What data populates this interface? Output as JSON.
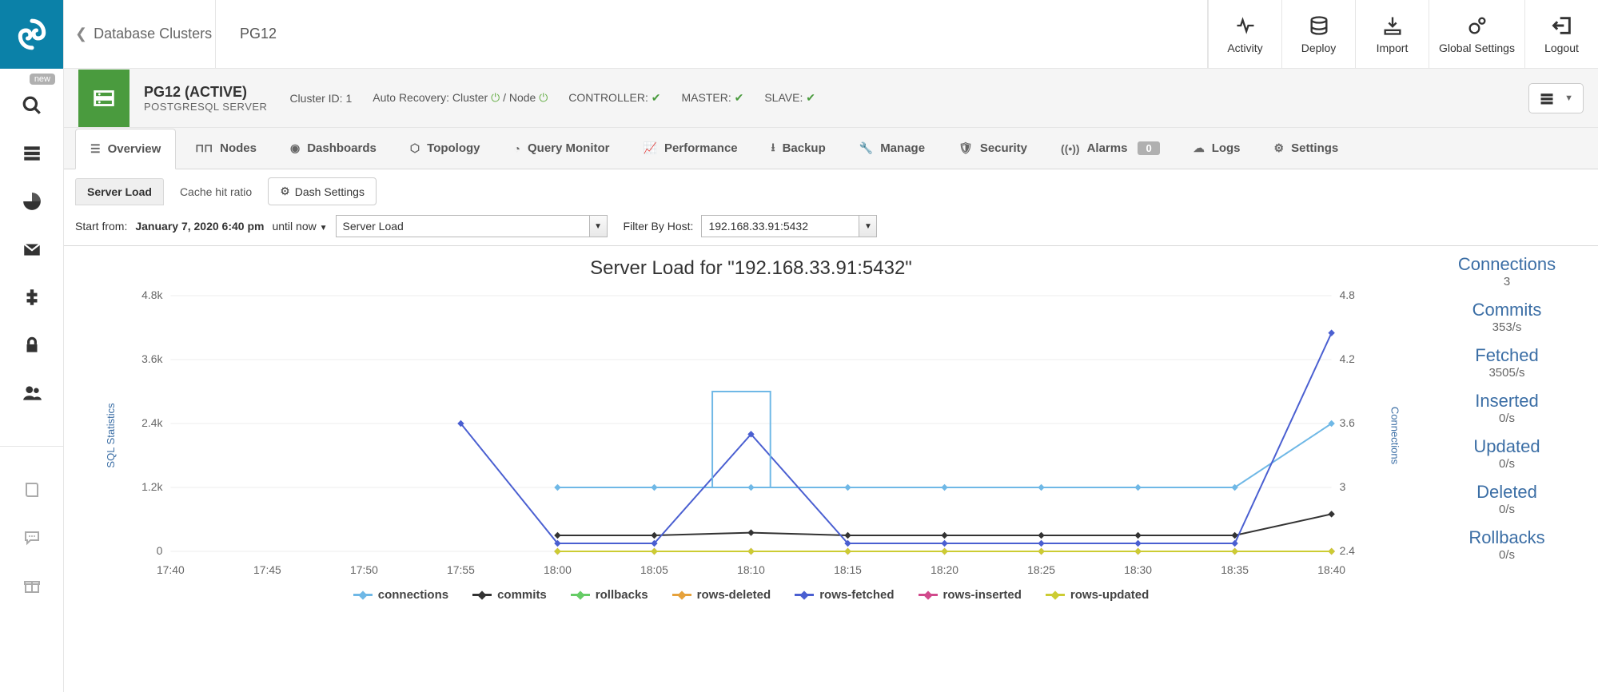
{
  "sidebar": {
    "new_label": "new"
  },
  "topbar": {
    "breadcrumb_back": "Database Clusters",
    "breadcrumb_current": "PG12",
    "actions": {
      "activity": "Activity",
      "deploy": "Deploy",
      "import": "Import",
      "global_settings": "Global Settings",
      "logout": "Logout"
    }
  },
  "cluster": {
    "title": "PG12 (ACTIVE)",
    "subtitle": "POSTGRESQL SERVER",
    "cluster_id_label": "Cluster ID: 1",
    "auto_recovery_label": "Auto Recovery: Cluster",
    "auto_recovery_sep": "/ Node",
    "controller_label": "CONTROLLER:",
    "master_label": "MASTER:",
    "slave_label": "SLAVE:"
  },
  "tabs": {
    "overview": "Overview",
    "nodes": "Nodes",
    "dashboards": "Dashboards",
    "topology": "Topology",
    "query_monitor": "Query Monitor",
    "performance": "Performance",
    "backup": "Backup",
    "manage": "Manage",
    "security": "Security",
    "alarms": "Alarms",
    "alarms_count": "0",
    "logs": "Logs",
    "settings": "Settings"
  },
  "subtabs": {
    "server_load": "Server Load",
    "cache_hit": "Cache hit ratio",
    "dash_settings": "Dash Settings"
  },
  "filters": {
    "start_from_label": "Start from:",
    "start_from_value": "January 7, 2020 6:40 pm",
    "until_label": "until now",
    "metric_select": "Server Load",
    "filter_by_host_label": "Filter By Host:",
    "host_select": "192.168.33.91:5432"
  },
  "chart": {
    "title": "Server Load for \"192.168.33.91:5432\"",
    "y_left_label": "SQL Statistics",
    "y_right_label": "Connections",
    "legend": {
      "connections": "connections",
      "commits": "commits",
      "rollbacks": "rollbacks",
      "rows_deleted": "rows-deleted",
      "rows_fetched": "rows-fetched",
      "rows_inserted": "rows-inserted",
      "rows_updated": "rows-updated"
    }
  },
  "chart_data": {
    "type": "line",
    "x": [
      "17:40",
      "17:45",
      "17:50",
      "17:55",
      "18:00",
      "18:05",
      "18:10",
      "18:15",
      "18:20",
      "18:25",
      "18:30",
      "18:35",
      "18:40"
    ],
    "y_left": {
      "label": "SQL Statistics",
      "ticks": [
        0,
        1200,
        2400,
        3600,
        4800
      ],
      "tick_labels": [
        "0",
        "1.2k",
        "2.4k",
        "3.6k",
        "4.8k"
      ]
    },
    "y_right": {
      "label": "Connections",
      "ticks": [
        2.4,
        3,
        3.6,
        4.2,
        4.8
      ]
    },
    "series": [
      {
        "name": "connections",
        "axis": "right",
        "color": "#6fb8e6",
        "values": [
          null,
          null,
          null,
          null,
          3,
          3,
          3,
          3,
          3,
          3,
          3,
          3,
          3.6
        ]
      },
      {
        "name": "commits",
        "axis": "left",
        "color": "#333333",
        "values": [
          null,
          null,
          null,
          null,
          300,
          300,
          350,
          300,
          300,
          300,
          300,
          300,
          700
        ]
      },
      {
        "name": "rollbacks",
        "axis": "left",
        "color": "#66cc66",
        "values": [
          null,
          null,
          null,
          null,
          0,
          0,
          0,
          0,
          0,
          0,
          0,
          0,
          0
        ]
      },
      {
        "name": "rows-deleted",
        "axis": "left",
        "color": "#e6a23c",
        "values": [
          null,
          null,
          null,
          null,
          0,
          0,
          0,
          0,
          0,
          0,
          0,
          0,
          0
        ]
      },
      {
        "name": "rows-fetched",
        "axis": "left",
        "color": "#4a5fd1",
        "values": [
          null,
          null,
          null,
          2400,
          150,
          150,
          2200,
          150,
          150,
          150,
          150,
          150,
          4100
        ]
      },
      {
        "name": "rows-inserted",
        "axis": "left",
        "color": "#d14a8c",
        "values": [
          null,
          null,
          null,
          null,
          0,
          0,
          0,
          0,
          0,
          0,
          0,
          0,
          0
        ]
      },
      {
        "name": "rows-updated",
        "axis": "left",
        "color": "#cccc33",
        "values": [
          null,
          null,
          null,
          null,
          0,
          0,
          0,
          0,
          0,
          0,
          0,
          0,
          0
        ]
      }
    ]
  },
  "stats": [
    {
      "label": "Connections",
      "value": "3"
    },
    {
      "label": "Commits",
      "value": "353/s"
    },
    {
      "label": "Fetched",
      "value": "3505/s"
    },
    {
      "label": "Inserted",
      "value": "0/s"
    },
    {
      "label": "Updated",
      "value": "0/s"
    },
    {
      "label": "Deleted",
      "value": "0/s"
    },
    {
      "label": "Rollbacks",
      "value": "0/s"
    }
  ]
}
